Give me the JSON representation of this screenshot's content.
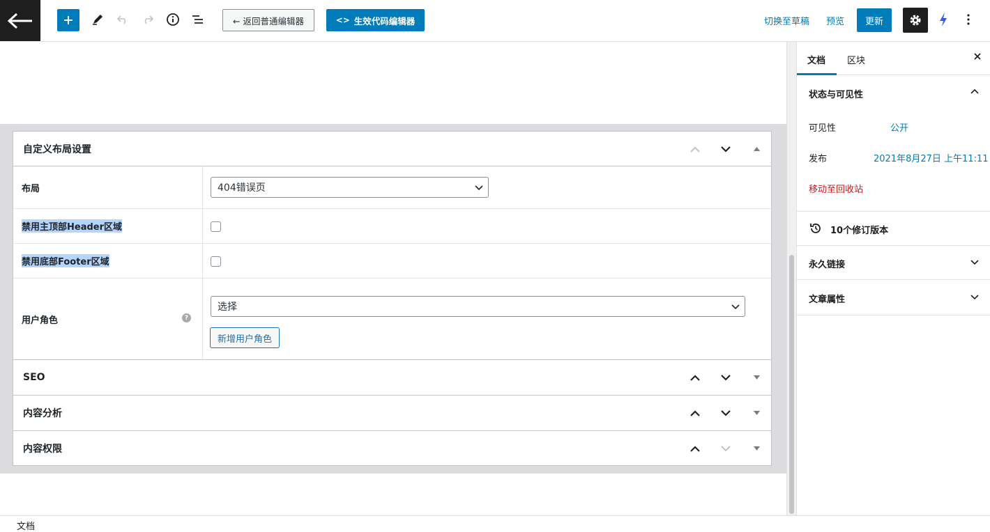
{
  "toolbar": {
    "classic_label": "← 返回普通编辑器",
    "code_editor_label": "生效代码编辑器",
    "switch_draft_label": "切换至草稿",
    "preview_label": "预览",
    "update_label": "更新"
  },
  "metaboxes": {
    "layout_box": {
      "title": "自定义布局设置",
      "fields": {
        "layout_label": "布局",
        "layout_value": "404错误页",
        "disable_header_label": "禁用主顶部Header区域",
        "disable_footer_label": "禁用底部Footer区域",
        "user_role_label": "用户角色",
        "user_role_value": "选择",
        "add_role_label": "新增用户角色",
        "help_glyph": "?"
      }
    },
    "seo_title": "SEO",
    "content_analysis_title": "内容分析",
    "content_permission_title": "内容权限"
  },
  "footer": {
    "breadcrumb": "文档"
  },
  "sidebar": {
    "tabs": {
      "document": "文档",
      "block": "区块"
    },
    "status_panel": {
      "title": "状态与可见性",
      "visibility_label": "可见性",
      "visibility_value": "公开",
      "publish_label": "发布",
      "publish_value": "2021年8月27日 上午11:11",
      "trash_label": "移动至回收站"
    },
    "revisions_label": "10个修订版本",
    "permalink_title": "永久链接",
    "attributes_title": "文章属性"
  },
  "colors": {
    "accent": "#007cba",
    "danger": "#cc1818",
    "dark": "#1e1e1e"
  }
}
